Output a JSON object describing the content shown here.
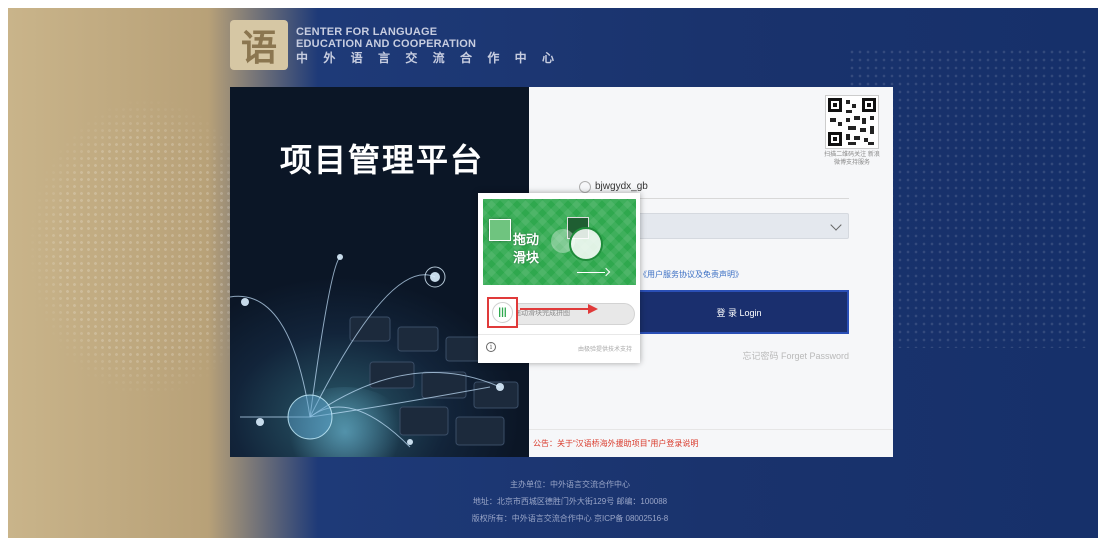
{
  "logo": {
    "line1": "CENTER FOR LANGUAGE",
    "line2": "EDUCATION AND COOPERATION",
    "line3": "中 外 语 言 交 流 合 作 中 心",
    "mark": "语"
  },
  "left_panel": {
    "title": "项目管理平台"
  },
  "login_form": {
    "qr_caption": "扫描二维码关注 新浪微博支持服务",
    "username": "bjwgydx_gb",
    "agree_text": "《用户服务协议及免责声明》",
    "login_button": "登 录 Login",
    "forgot_password": "忘记密码 Forget Password",
    "notice": "公告：关于“汉语桥海外援助项目”用户登录说明"
  },
  "captcha": {
    "drag_text_line1": "拖动",
    "drag_text_line2": "滑块",
    "track_placeholder": "拖动滑块完成拼图",
    "handle_glyph": "|||",
    "info_glyph": "i",
    "brand_text": "由极验提供技术支持"
  },
  "footer": {
    "host": "主办单位：中外语言交流合作中心",
    "address": "地址：北京市西城区德胜门外大街129号 邮编：100088",
    "copyright": "版权所有：中外语言交流合作中心 京ICP备 08002516-8"
  },
  "colors": {
    "accent": "#1a2f6e",
    "captcha_green": "#2fa84e",
    "highlight_red": "#e03a3a",
    "notice_red": "#d93a2b"
  }
}
